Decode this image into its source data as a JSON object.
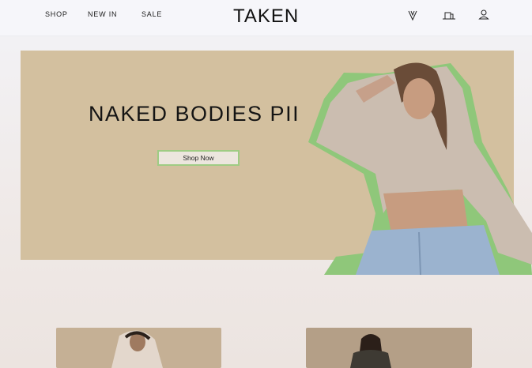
{
  "header": {
    "nav": [
      "SHOP",
      "NEW IN",
      "SALE"
    ],
    "logo": "TAKEN",
    "icons": [
      "wishlist-icon",
      "cart-icon",
      "account-icon"
    ]
  },
  "hero": {
    "title": "NAKED BODIES PII",
    "button_label": "Shop Now",
    "background": "#d3c09f",
    "accent": "#9fcc84"
  },
  "cards": [
    "product-card-left",
    "product-card-right"
  ]
}
